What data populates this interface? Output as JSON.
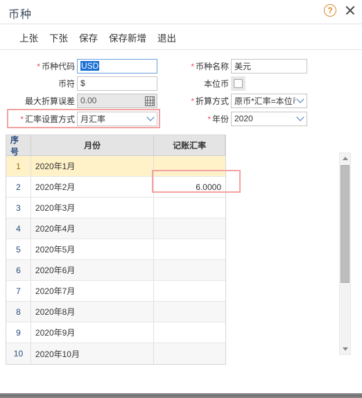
{
  "window": {
    "title": "币种",
    "help_icon": "help-circle-icon",
    "help_glyph": "?",
    "close_icon": "close-icon"
  },
  "toolbar": {
    "items": [
      {
        "label": "上张"
      },
      {
        "label": "下张"
      },
      {
        "label": "保存"
      },
      {
        "label": "保存新增"
      },
      {
        "label": "退出"
      }
    ]
  },
  "form": {
    "required_marker": "*",
    "fields": {
      "currency_code": {
        "label": "币种代码",
        "value": "USD",
        "required": true,
        "state": "focused-selected"
      },
      "currency_symbol": {
        "label": "币符",
        "value": "$",
        "required": false
      },
      "max_conversion_error": {
        "label": "最大折算误差",
        "value": "0.00",
        "required": false,
        "state": "disabled",
        "icon": "calculator-icon"
      },
      "rate_setting_method": {
        "label": "汇率设置方式",
        "value": "月汇率",
        "required": true,
        "type": "dropdown",
        "highlighted": true
      },
      "currency_name": {
        "label": "币种名称",
        "value": "美元",
        "required": true
      },
      "base_currency": {
        "label": "本位币",
        "value": "",
        "required": false,
        "type": "checkbox",
        "checked": false
      },
      "conversion_method": {
        "label": "折算方式",
        "value": "原币*汇率=本位币",
        "required": true,
        "type": "dropdown"
      },
      "year": {
        "label": "年份",
        "value": "2020",
        "required": true,
        "type": "dropdown"
      }
    }
  },
  "grid": {
    "columns": [
      {
        "key": "no",
        "label": "序号"
      },
      {
        "key": "month",
        "label": "月份"
      },
      {
        "key": "rate",
        "label": "记账汇率"
      }
    ],
    "rows": [
      {
        "no": "1",
        "month": "2020年1月",
        "rate": "",
        "selected": true
      },
      {
        "no": "2",
        "month": "2020年2月",
        "rate": "6.0000",
        "highlighted": true
      },
      {
        "no": "3",
        "month": "2020年3月",
        "rate": ""
      },
      {
        "no": "4",
        "month": "2020年4月",
        "rate": ""
      },
      {
        "no": "5",
        "month": "2020年5月",
        "rate": ""
      },
      {
        "no": "6",
        "month": "2020年6月",
        "rate": ""
      },
      {
        "no": "7",
        "month": "2020年7月",
        "rate": ""
      },
      {
        "no": "8",
        "month": "2020年8月",
        "rate": ""
      },
      {
        "no": "9",
        "month": "2020年9月",
        "rate": ""
      },
      {
        "no": "10",
        "month": "2020年10月",
        "rate": ""
      }
    ]
  },
  "scrollbar": {
    "up_icon": "triangle-up-icon",
    "down_icon": "triangle-down-icon"
  },
  "colors": {
    "required_red": "#e8505b",
    "annotation_red": "#f4a0a0",
    "selected_row": "#fff2c9",
    "header_gray": "#e4e4e4",
    "focus_blue": "#6a9fe0",
    "help_orange": "#d98b2b"
  }
}
